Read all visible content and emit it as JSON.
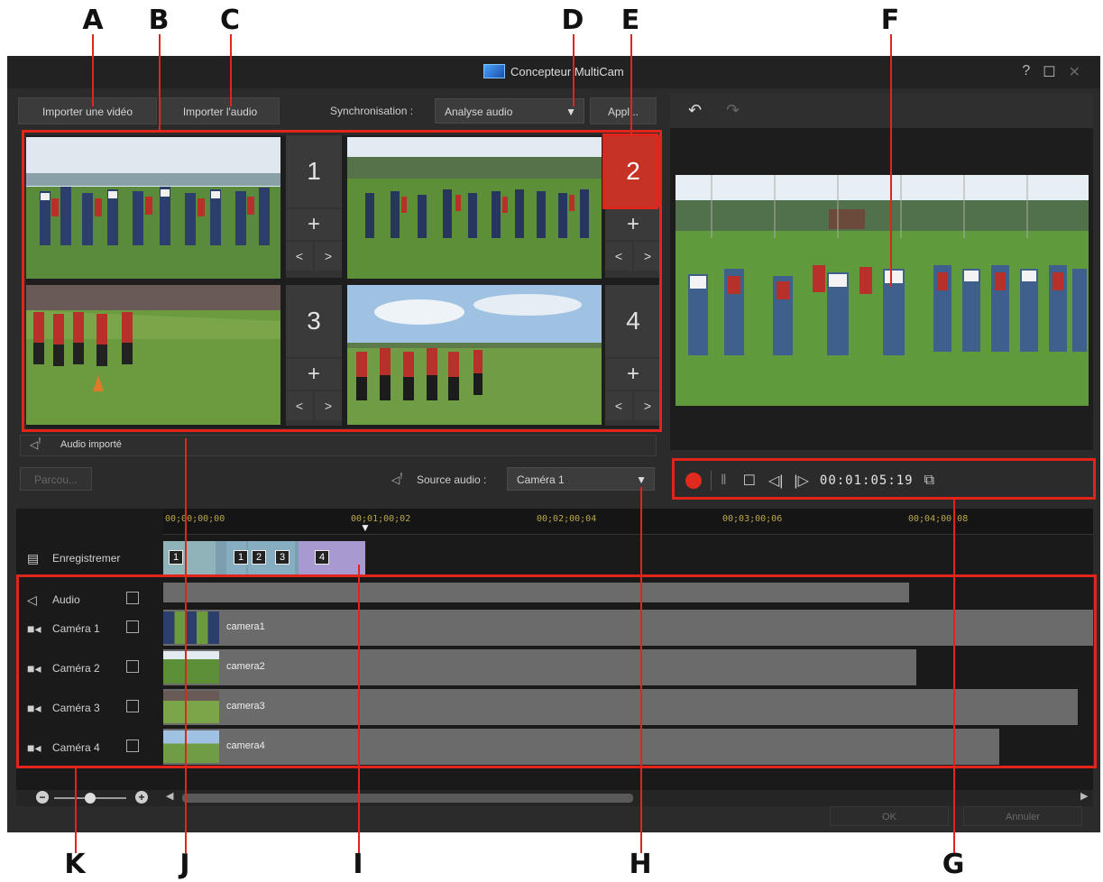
{
  "window": {
    "title": "Concepteur MultiCam",
    "help": "?",
    "maximize": "☐",
    "close": "✕"
  },
  "callouts": {
    "top": [
      "A",
      "B",
      "C",
      "D",
      "E",
      "F"
    ],
    "bottom": [
      "K",
      "J",
      "I",
      "H",
      "G"
    ]
  },
  "toolbar": {
    "import_video": "Importer une vidéo",
    "import_audio": "Importer l'audio",
    "sync_label": "Synchronisation :",
    "sync_value": "Analyse audio",
    "apply": "Appl..."
  },
  "cameras": [
    {
      "number": "1",
      "active": false
    },
    {
      "number": "2",
      "active": true
    },
    {
      "number": "3",
      "active": false
    },
    {
      "number": "4",
      "active": false
    }
  ],
  "audio_imported": "Audio importé",
  "audio_source": {
    "left_button": "Parcou...",
    "label": "Source audio :",
    "value": "Caméra 1"
  },
  "transport": {
    "timecode": "00:01:05:19"
  },
  "timeline": {
    "ticks": [
      "00;00;00;00",
      "00;01;00;02",
      "00;02;00;04",
      "00;03;00;06",
      "00;04;00;08"
    ],
    "record_label": "Enregistremer",
    "record_clips": [
      "1",
      "2",
      "3",
      "4"
    ],
    "tracks": [
      {
        "label": "Audio",
        "clip": ""
      },
      {
        "label": "Caméra 1",
        "clip": "camera1"
      },
      {
        "label": "Caméra 2",
        "clip": "camera2"
      },
      {
        "label": "Caméra 3",
        "clip": "camera3"
      },
      {
        "label": "Caméra 4",
        "clip": "camera4"
      }
    ]
  },
  "footer": {
    "ok": "OK",
    "cancel": "Annuler"
  },
  "colors": {
    "accent_red": "#e1251b",
    "active_camera": "#c63224",
    "ruler_text": "#b8a64a"
  }
}
